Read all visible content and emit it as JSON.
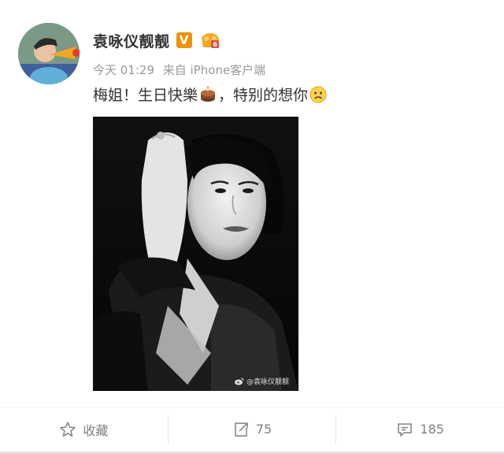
{
  "post": {
    "author": {
      "name": "袁咏仪靓靓",
      "verified_badge": "V",
      "level_badge_icon": "level-6-icon"
    },
    "meta": {
      "time": "今天 01:29",
      "source": "来自 iPhone客户端"
    },
    "content": {
      "part1": "梅姐！生日快樂",
      "part2": "，特别的想你"
    },
    "image": {
      "watermark": "@袁咏仪靓靓"
    }
  },
  "actions": {
    "favorite": {
      "label": "收藏"
    },
    "repost": {
      "count": "75"
    },
    "comment": {
      "count": "185"
    }
  },
  "colors": {
    "accent": "#f29100",
    "meta": "#999999",
    "action": "#808080"
  }
}
